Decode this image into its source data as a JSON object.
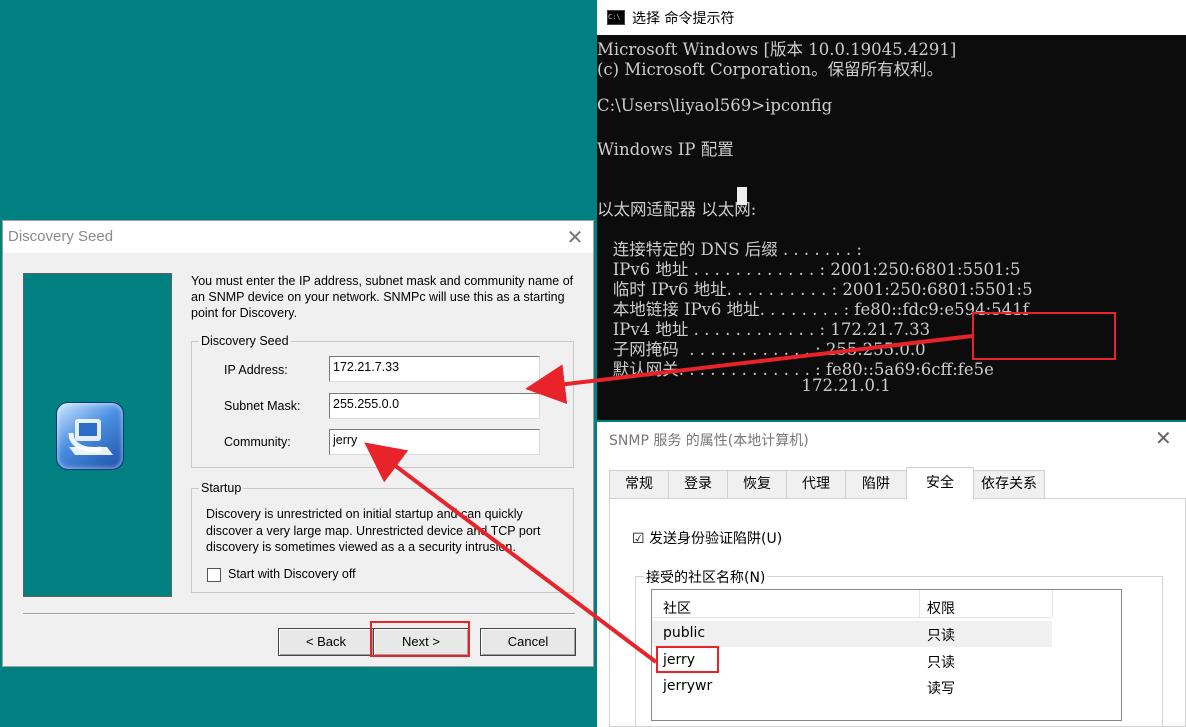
{
  "discovery_dialog": {
    "title": "Discovery Seed",
    "intro_text": "You must enter the IP address, subnet mask and community name of an SNMP device on your network. SNMPc will use this as a starting point for Discovery.",
    "seed_group": {
      "label": "Discovery Seed",
      "ip_label": "IP Address:",
      "ip_value": "172.21.7.33",
      "mask_label": "Subnet Mask:",
      "mask_value": "255.255.0.0",
      "community_label": "Community:",
      "community_value": "jerry"
    },
    "startup_group": {
      "label": "Startup",
      "text": "Discovery is unrestricted on initial startup and can quickly discover a very large map.  Unrestricted device and TCP port discovery is sometimes viewed as a a security intrusion.",
      "checkbox_label": "Start with Discovery off",
      "checked": false
    },
    "buttons": {
      "back": "< Back",
      "next": "Next >",
      "cancel": "Cancel"
    }
  },
  "cmd_window": {
    "title": "选择 命令提示符",
    "icon_text": "C:\\",
    "lines": [
      "Microsoft Windows [版本 10.0.19045.4291]",
      "(c) Microsoft Corporation。保留所有权利。",
      "C:\\Users\\liyaol569>ipconfig",
      "Windows IP 配置",
      "以太网适配器 以太网:",
      "   连接特定的 DNS 后缀 . . . . . . . :",
      "   IPv6 地址 . . . . . . . . . . . . : 2001:250:6801:5501:5",
      "   临时 IPv6 地址. . . . . . . . . . : 2001:250:6801:5501:5",
      "   本地链接 IPv6 地址. . . . . . . . : fe80::fdc9:e594:541f",
      "   IPv4 地址 . . . . . . . . . . . . : 172.21.7.33",
      "   子网掩码  . . . . . . . . . . . . : 255.255.0.0",
      "   默认网关. . . . . . . . . . . . . : fe80::5a69:6cff:fe5e",
      "                                       172.21.0.1"
    ]
  },
  "snmp_dialog": {
    "title": "SNMP 服务 的属性(本地计算机)",
    "tabs": [
      "常规",
      "登录",
      "恢复",
      "代理",
      "陷阱",
      "安全",
      "依存关系"
    ],
    "active_tab": "安全",
    "trap_checkbox": "☑ 发送身份验证陷阱(U)",
    "group_label": "接受的社区名称(N)",
    "columns": [
      "社区",
      "权限"
    ],
    "rows": [
      {
        "community": "public",
        "permission": "只读"
      },
      {
        "community": "jerry",
        "permission": "只读"
      },
      {
        "community": "jerrywr",
        "permission": "读写"
      }
    ]
  },
  "colors": {
    "desktop": "#008080",
    "annotation": "#e8232a",
    "console_bg": "#0c0c0c",
    "console_fg": "#cccccc"
  }
}
